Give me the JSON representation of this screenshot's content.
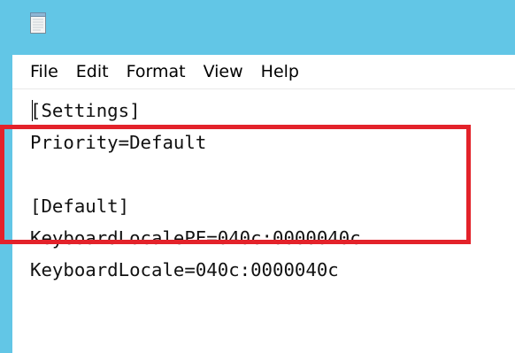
{
  "window": {
    "app_icon": "notepad-icon",
    "accent_color": "#62c6e6"
  },
  "menu": {
    "items": [
      "File",
      "Edit",
      "Format",
      "View",
      "Help"
    ]
  },
  "document": {
    "lines": [
      "[Settings]",
      "Priority=Default",
      "",
      "[Default]",
      "KeyboardLocalePE=040c:0000040c",
      "KeyboardLocale=040c:0000040c"
    ]
  },
  "annotation": {
    "highlight_color": "#e3222a"
  }
}
